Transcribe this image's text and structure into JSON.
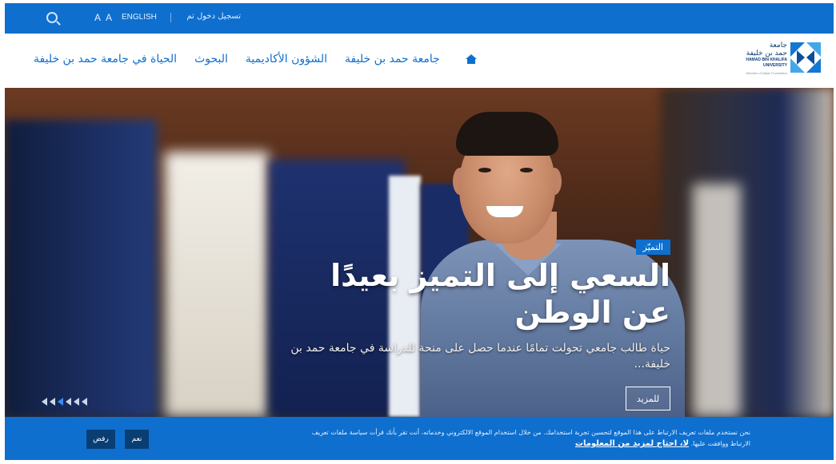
{
  "topbar": {
    "font_size": "A A",
    "language": "ENGLISH",
    "login": "تسجيل دخول تم"
  },
  "nav": {
    "items": [
      "الحياة في جامعة حمد بن خليفة",
      "البحوث",
      "الشؤون الأكاديمية",
      "جامعة حمد بن خليفة"
    ]
  },
  "logo": {
    "ar_line1": "جامعة",
    "ar_line2": "حمد بن خليفة",
    "en_line1": "HAMAD BIN KHALIFA",
    "en_line2": "UNIVERSITY",
    "member": "Member of Qatar Foundation"
  },
  "hero": {
    "badge": "التميّز",
    "title": "السعي إلى التميز بعيدًا عن الوطن",
    "subtitle": "حياة طالب جامعي تحولت تمامًا عندما حصل على منحة للدراسة في جامعة حمد بن خليفة...",
    "more": "للمزيد",
    "slides_count": 6,
    "active_slide": 3
  },
  "cookie": {
    "text": "نحن نستخدم ملفات تعريف الارتباط على هذا الموقع لتحسين تجربة استخدامك. من خلال استخدام الموقع الالكتروني وخدماته، أنت تقر بأنك قرأت سياسة ملفات تعريف الارتباط ووافقت عليها.",
    "link": "لا، احتاج لمزيد من المعلومات",
    "yes": "نعم",
    "reject": "رفض"
  },
  "colors": {
    "brand_blue": "#0e6fce",
    "dark_button": "#093e74"
  }
}
